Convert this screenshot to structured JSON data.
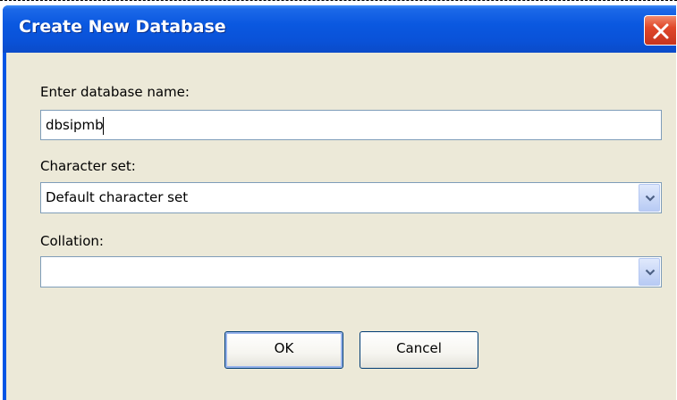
{
  "window": {
    "title": "Create New Database",
    "close_icon": "close-icon"
  },
  "form": {
    "name_label": "Enter database name:",
    "name_value": "dbsipmb",
    "charset_label": "Character set:",
    "charset_value": "Default character set",
    "collation_label": "Collation:",
    "collation_value": ""
  },
  "buttons": {
    "ok": "OK",
    "cancel": "Cancel"
  },
  "colors": {
    "titlebar": "#0a58e0",
    "client_bg": "#ece9d8",
    "close_button": "#e0482a",
    "button_border": "#003c74"
  }
}
